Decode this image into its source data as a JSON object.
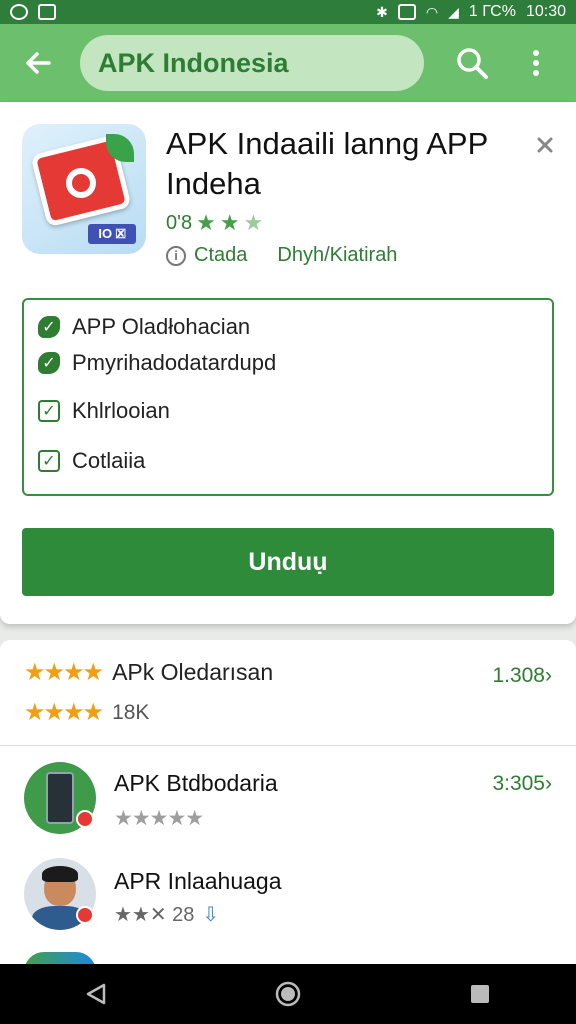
{
  "status_bar": {
    "left_icons": [
      "alarm-icon",
      "photo-icon"
    ],
    "battery_text": "1 ГС%",
    "time": "10:30"
  },
  "app_bar": {
    "search_text": "APK Indonesia"
  },
  "app_card": {
    "title": "APK Indaaili lanng APP Indeha",
    "rating_text": "0'8",
    "meta_left": "Ctada",
    "meta_right": "Dhyh/Kiatirah",
    "checklist": [
      {
        "label": "APP Oladłohacian"
      },
      {
        "label": "Pmyrihadodatardupd"
      },
      {
        "label": "Khlrlooian"
      },
      {
        "label": "Cotlaiia"
      }
    ],
    "download_label": "Unduụ",
    "icon_tag": "IO 🗷"
  },
  "rating_summary": {
    "title": "APk Oledarısan",
    "count": "18K",
    "right_value": "1.308"
  },
  "list": [
    {
      "title": "APK Btdbodaria",
      "right_value": "3:305",
      "stars_text": "★★★★★"
    },
    {
      "title": "APR Inlaahuaga",
      "sub_text": "★★✕ 28"
    }
  ],
  "colors": {
    "status_bar": "#2f7d3a",
    "app_bar": "#6cbf6c",
    "accent_green": "#2e8b3a",
    "star_orange": "#f29d12"
  }
}
